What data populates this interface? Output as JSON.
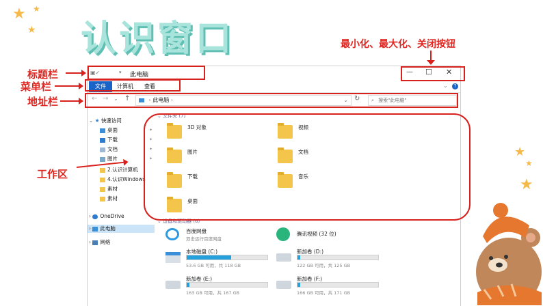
{
  "slide": {
    "title": "认识窗口",
    "annotations": {
      "title_bar": "标题栏",
      "menu_bar": "菜单栏",
      "address_bar": "地址栏",
      "work_area": "工作区",
      "window_buttons": "最小化、最大化、关闭按钮"
    }
  },
  "window": {
    "title": "此电脑",
    "tabs": [
      "文件",
      "计算机",
      "查看"
    ],
    "address": "此电脑",
    "search_placeholder": "搜索\"此电脑\"",
    "sidebar": {
      "quick_access": "快速访问",
      "items": [
        "桌面",
        "下载",
        "文档",
        "图片",
        "2.认识计算机",
        "4.认识Windows",
        "素材",
        "素材"
      ],
      "onedrive": "OneDrive",
      "this_pc": "此电脑",
      "network": "网络"
    },
    "folders_header": "文件夹 (7)",
    "folders": [
      "3D 对象",
      "视频",
      "图片",
      "文档",
      "下载",
      "音乐",
      "桌面"
    ],
    "devices_header": "设备和驱动器 (6)",
    "apps": [
      {
        "name": "百度网盘",
        "sub": "双击运行百度网盘"
      },
      {
        "name": "腾讯视频 (32 位)",
        "sub": ""
      }
    ],
    "drives": [
      {
        "name": "本地磁盘 (C:)",
        "space": "53.6 GB 可用，共 118 GB",
        "used": 0.55
      },
      {
        "name": "新加卷 (D:)",
        "space": "122 GB 可用，共 125 GB",
        "used": 0.03
      },
      {
        "name": "新加卷 (E:)",
        "space": "163 GB 可用，共 167 GB",
        "used": 0.03
      },
      {
        "name": "新加卷 (F:)",
        "space": "166 GB 可用，共 171 GB",
        "used": 0.03
      }
    ]
  }
}
